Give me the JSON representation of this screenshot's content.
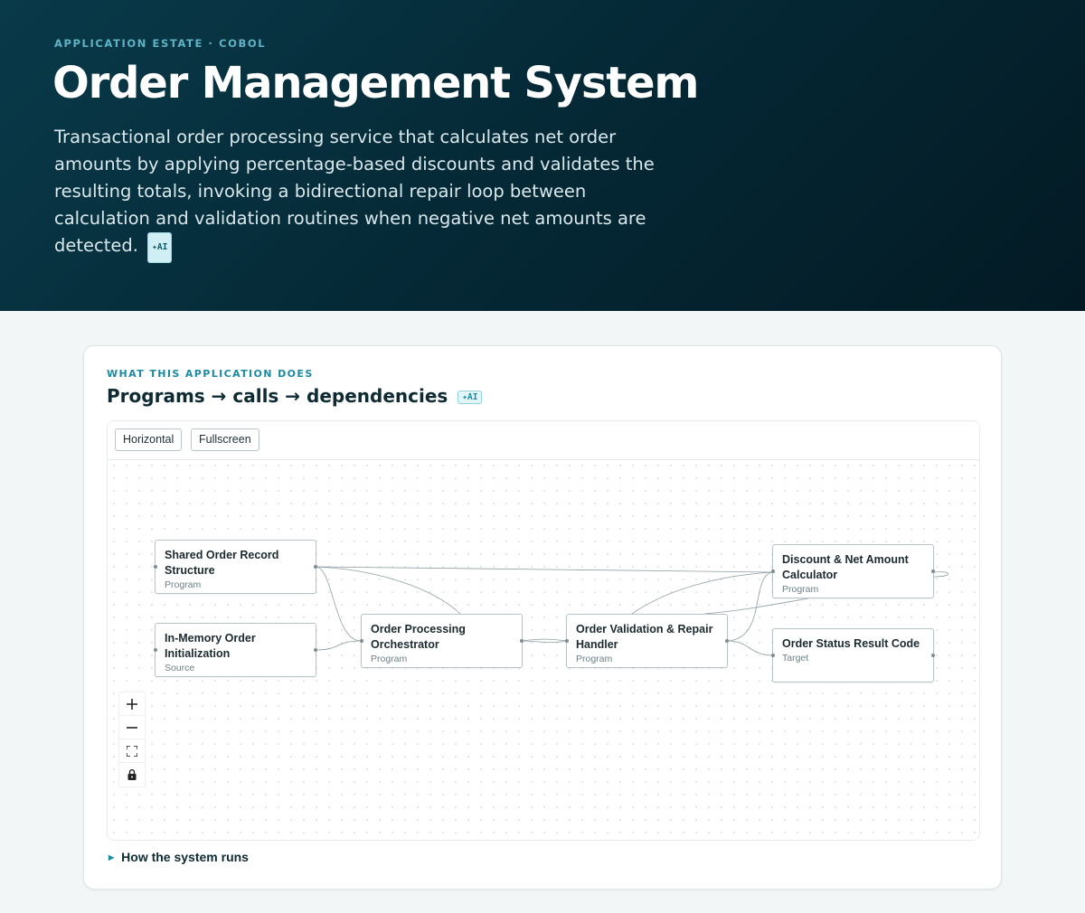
{
  "hero": {
    "eyebrow": "APPLICATION ESTATE · COBOL",
    "title": "Order Management System",
    "description": "Transactional order processing service that calculates net order amounts by applying percentage-based discounts and validates the resulting totals, invoking a bidirectional repair loop between calculation and validation routines when negative net amounts are detected.",
    "ai_badge": "✦AI"
  },
  "section": {
    "eyebrow": "WHAT THIS APPLICATION DOES",
    "title": "Programs → calls → dependencies",
    "ai_badge": "✦AI"
  },
  "toolbar": {
    "horizontal_label": "Horizontal",
    "fullscreen_label": "Fullscreen"
  },
  "graph": {
    "nodes": [
      {
        "id": "shared",
        "label": "Shared Order Record Structure",
        "kind": "Program"
      },
      {
        "id": "init",
        "label": "In-Memory Order Initialization",
        "kind": "Source"
      },
      {
        "id": "orch",
        "label": "Order Processing Orchestrator",
        "kind": "Program"
      },
      {
        "id": "valid",
        "label": "Order Validation & Repair Handler",
        "kind": "Program"
      },
      {
        "id": "calc",
        "label": "Discount & Net Amount Calculator",
        "kind": "Program"
      },
      {
        "id": "status",
        "label": "Order Status Result Code",
        "kind": "Target"
      }
    ],
    "edges": [
      {
        "from": "init",
        "to": "orch"
      },
      {
        "from": "shared",
        "to": "orch"
      },
      {
        "from": "shared",
        "to": "valid"
      },
      {
        "from": "shared",
        "to": "calc"
      },
      {
        "from": "orch",
        "to": "valid"
      },
      {
        "from": "valid",
        "to": "calc"
      },
      {
        "from": "calc",
        "to": "valid"
      },
      {
        "from": "valid",
        "to": "status"
      },
      {
        "from": "calc",
        "to": "calc"
      }
    ]
  },
  "controls": {
    "zoom_in": "plus-icon",
    "zoom_out": "minus-icon",
    "fit_view": "fit-view-icon",
    "lock": "lock-icon"
  },
  "disclosure": {
    "label": "How the system runs"
  },
  "colors": {
    "hero_bg": "#052a37",
    "accent": "#1c8aa0",
    "edge": "#8f9da1"
  }
}
